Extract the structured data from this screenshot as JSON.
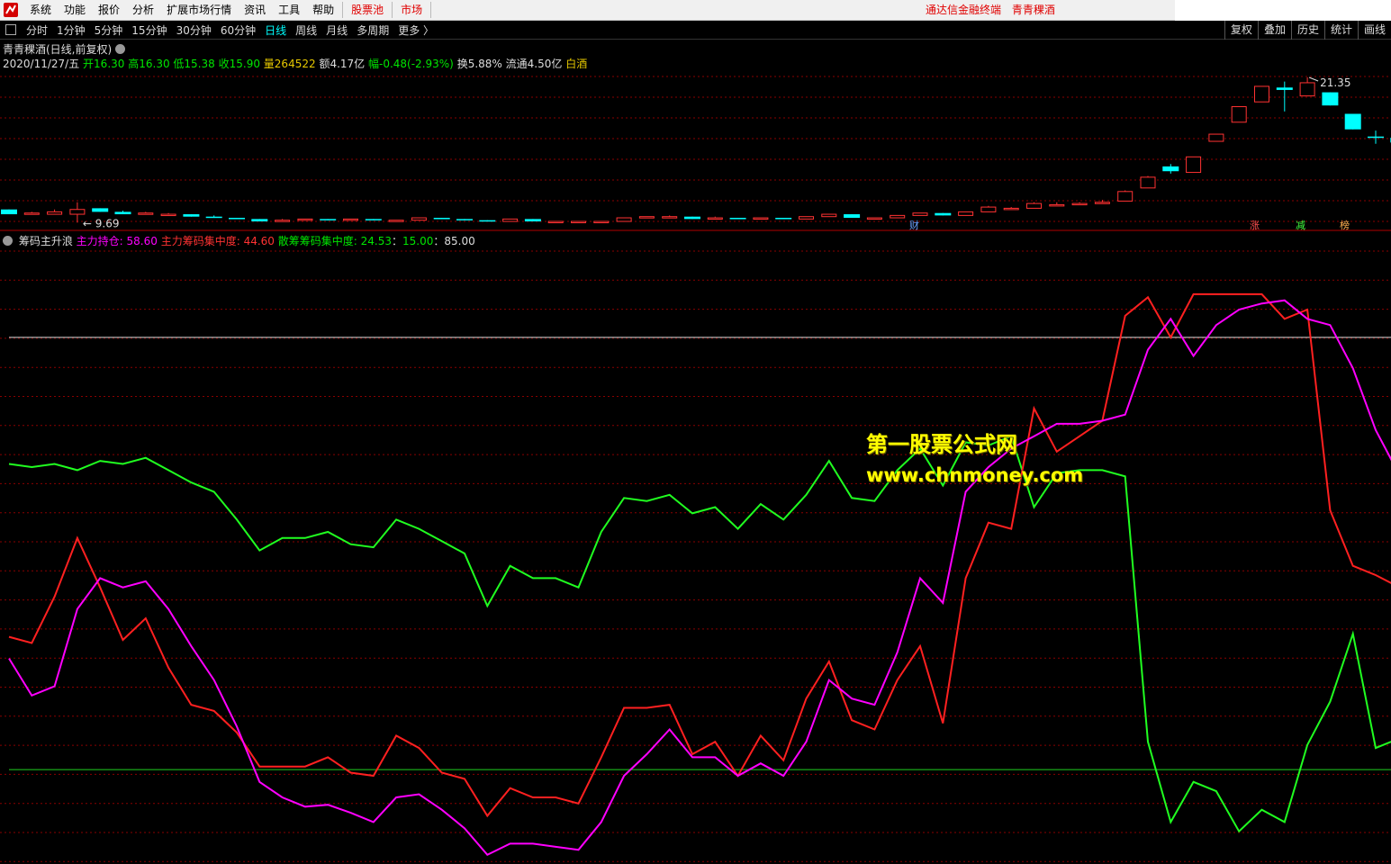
{
  "menu": {
    "items": [
      "系统",
      "功能",
      "报价",
      "分析",
      "扩展市场行情",
      "资讯",
      "工具",
      "帮助"
    ],
    "red_items": [
      "股票池",
      "市场"
    ],
    "center_title": [
      "通达信金融终端",
      "青青稞酒"
    ]
  },
  "toolbar": {
    "periods": [
      "分时",
      "1分钟",
      "5分钟",
      "15分钟",
      "30分钟",
      "60分钟",
      "日线",
      "周线",
      "月线",
      "多周期",
      "更多 〉"
    ],
    "active_period": "日线",
    "right_buttons": [
      "复权",
      "叠加",
      "历史",
      "统计",
      "画线"
    ]
  },
  "stock": {
    "title": "青青稞酒(日线,前复权)",
    "date": "2020/11/27/五",
    "open": "开16.30",
    "high": "高16.30",
    "low": "低15.38",
    "close": "收15.90",
    "volume": "量264522",
    "amount": "额4.17亿",
    "change": "幅-0.48(-2.93%)",
    "turnover": "换5.88%",
    "float": "流通4.50亿",
    "sector": "白酒",
    "high_mark": "21.35",
    "low_mark": "9.69",
    "badges": [
      "财",
      "涨",
      "减",
      "榜"
    ]
  },
  "indicator": {
    "name": "筹码主升浪",
    "l1": "主力持仓: 58.60",
    "l2": "主力筹码集中度: 44.60",
    "l3": "散筹筹码集中度: 24.53",
    "l4": "15.00",
    "l5": "85.00",
    "ref_levels": [
      85,
      15
    ],
    "ymin": 0,
    "ymax": 100
  },
  "colors": {
    "up": "#ff3232",
    "down": "#00ffff",
    "main_hold": "#ff00ff",
    "main_conc": "#ff2020",
    "retail_conc": "#20ff20",
    "grid": "#8a0000"
  },
  "watermark": {
    "line1": "第一股票公式网",
    "line2": "www.chnmoney.com"
  },
  "candles": [
    [
      10.3,
      10.3,
      9.9,
      9.9
    ],
    [
      10.0,
      10.1,
      9.9,
      10.0
    ],
    [
      9.9,
      10.3,
      9.9,
      10.1
    ],
    [
      9.9,
      10.9,
      9.2,
      10.3
    ],
    [
      10.4,
      10.4,
      10.1,
      10.1
    ],
    [
      10.1,
      10.2,
      9.9,
      9.9
    ],
    [
      9.9,
      10.1,
      9.9,
      10.0
    ],
    [
      9.9,
      10.0,
      9.8,
      9.9
    ],
    [
      9.9,
      9.9,
      9.7,
      9.7
    ],
    [
      9.7,
      9.8,
      9.6,
      9.6
    ],
    [
      9.6,
      9.6,
      9.5,
      9.5
    ],
    [
      9.5,
      9.5,
      9.3,
      9.3
    ],
    [
      9.3,
      9.5,
      9.3,
      9.4
    ],
    [
      9.4,
      9.5,
      9.4,
      9.5
    ],
    [
      9.5,
      9.5,
      9.4,
      9.4
    ],
    [
      9.4,
      9.5,
      9.4,
      9.5
    ],
    [
      9.5,
      9.5,
      9.4,
      9.4
    ],
    [
      9.4,
      9.4,
      9.4,
      9.4
    ],
    [
      9.4,
      9.6,
      9.4,
      9.6
    ],
    [
      9.6,
      9.6,
      9.5,
      9.5
    ],
    [
      9.5,
      9.5,
      9.4,
      9.4
    ],
    [
      9.4,
      9.4,
      9.3,
      9.3
    ],
    [
      9.3,
      9.5,
      9.3,
      9.5
    ],
    [
      9.5,
      9.5,
      9.3,
      9.3
    ],
    [
      9.3,
      9.3,
      9.3,
      9.3
    ],
    [
      9.3,
      9.3,
      9.3,
      9.3
    ],
    [
      9.3,
      9.3,
      9.3,
      9.3
    ],
    [
      9.3,
      9.6,
      9.3,
      9.6
    ],
    [
      9.6,
      9.7,
      9.6,
      9.7
    ],
    [
      9.6,
      9.8,
      9.6,
      9.7
    ],
    [
      9.7,
      9.7,
      9.5,
      9.5
    ],
    [
      9.5,
      9.7,
      9.5,
      9.6
    ],
    [
      9.6,
      9.6,
      9.5,
      9.5
    ],
    [
      9.5,
      9.6,
      9.5,
      9.6
    ],
    [
      9.6,
      9.6,
      9.5,
      9.5
    ],
    [
      9.5,
      9.7,
      9.5,
      9.7
    ],
    [
      9.7,
      9.9,
      9.7,
      9.9
    ],
    [
      9.9,
      9.9,
      9.6,
      9.6
    ],
    [
      9.6,
      9.6,
      9.6,
      9.6
    ],
    [
      9.6,
      9.8,
      9.6,
      9.8
    ],
    [
      9.8,
      10.0,
      9.8,
      10.0
    ],
    [
      10.0,
      10.0,
      9.8,
      9.8
    ],
    [
      9.8,
      10.1,
      9.8,
      10.1
    ],
    [
      10.1,
      10.6,
      10.1,
      10.5
    ],
    [
      10.3,
      10.5,
      10.3,
      10.4
    ],
    [
      10.4,
      10.9,
      10.4,
      10.8
    ],
    [
      10.7,
      10.9,
      10.6,
      10.7
    ],
    [
      10.7,
      10.9,
      10.7,
      10.8
    ],
    [
      10.8,
      11.1,
      10.8,
      10.9
    ],
    [
      11.0,
      11.9,
      11.0,
      11.8
    ],
    [
      12.1,
      13.1,
      12.1,
      13.0
    ],
    [
      13.9,
      14.1,
      13.3,
      13.5
    ],
    [
      13.4,
      14.7,
      13.4,
      14.7
    ],
    [
      16.0,
      16.6,
      16.0,
      16.6
    ],
    [
      17.6,
      18.9,
      17.6,
      18.9
    ],
    [
      19.3,
      20.6,
      19.3,
      20.6
    ],
    [
      20.5,
      21.0,
      18.5,
      20.3
    ],
    [
      19.8,
      21.35,
      19.8,
      20.9
    ],
    [
      20.1,
      20.1,
      19.0,
      19.0
    ],
    [
      18.3,
      18.3,
      17.0,
      17.0
    ],
    [
      16.4,
      16.9,
      15.8,
      16.3
    ],
    [
      16.3,
      16.3,
      15.38,
      15.9
    ]
  ],
  "series": {
    "main_hold": [
      33,
      27,
      28.5,
      41,
      46,
      44.5,
      45.5,
      41,
      35,
      29.5,
      22,
      13,
      10.5,
      9,
      9.3,
      8,
      6.5,
      10.5,
      11,
      8.5,
      5.5,
      1.2,
      3,
      3,
      2.5,
      2,
      6.5,
      14,
      17.5,
      21.5,
      17,
      17,
      14,
      16,
      14,
      19.5,
      29.5,
      26.5,
      25.5,
      34,
      46,
      42,
      60,
      64,
      67,
      69,
      71,
      71,
      71.5,
      72.5,
      83,
      88,
      82,
      87,
      89.5,
      90.5,
      91,
      88,
      87,
      80,
      70,
      63,
      58.6
    ],
    "main_conc": [
      36.5,
      35.5,
      43,
      52.5,
      44.5,
      36,
      39.5,
      31.5,
      25.5,
      24.5,
      21,
      15.5,
      15.5,
      15.5,
      17,
      14.5,
      14,
      20.5,
      18.5,
      14.5,
      13.5,
      7.5,
      12,
      10.5,
      10.5,
      9.5,
      17,
      25,
      25,
      25.5,
      17.5,
      19.5,
      14,
      20.5,
      16.5,
      26.5,
      32.5,
      23,
      21.5,
      29.5,
      35,
      22.5,
      46,
      55,
      54,
      73.5,
      66.5,
      69,
      71.5,
      88.5,
      91.5,
      85,
      92,
      92,
      92,
      92,
      88,
      89.5,
      57,
      48,
      46.5,
      44.6
    ],
    "retail_conc": [
      64.5,
      64,
      64.5,
      63.5,
      65,
      64.5,
      65.5,
      63.5,
      61.5,
      60,
      55.5,
      50.5,
      52.5,
      52.5,
      53.5,
      51.5,
      51,
      55.5,
      54,
      52,
      50,
      41.5,
      48,
      46,
      46,
      44.5,
      53.5,
      59,
      58.5,
      59.5,
      56.5,
      57.5,
      54,
      58,
      55.5,
      59.5,
      65,
      59,
      58.5,
      63.5,
      67,
      61,
      68,
      67.5,
      69,
      57.5,
      63,
      63.5,
      63.5,
      62.5,
      19.5,
      6.5,
      13,
      11.5,
      5,
      8.5,
      6.5,
      19,
      26,
      37,
      18.5,
      20,
      24.53
    ]
  }
}
